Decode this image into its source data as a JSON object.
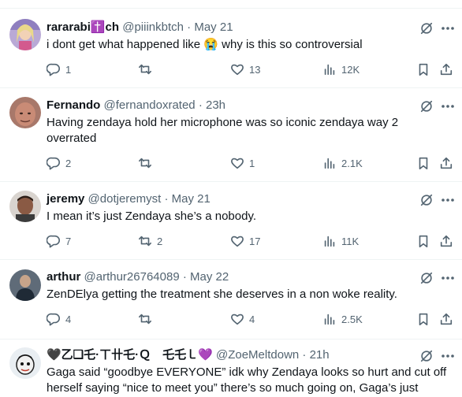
{
  "tweets": [
    {
      "display_name": "rararabi✝️ch",
      "handle": "@piiinkbtch",
      "separator": "·",
      "time": "May 21",
      "text": "i dont get what happened like 😭 why is this so controversial",
      "replies": "1",
      "retweets": "",
      "likes": "13",
      "views": "12K"
    },
    {
      "display_name": "Fernando",
      "handle": "@fernandoxrated",
      "separator": "·",
      "time": "23h",
      "text": "Having zendaya hold her microphone was so iconic zendaya way 2 overrated",
      "replies": "2",
      "retweets": "",
      "likes": "1",
      "views": "2.1K"
    },
    {
      "display_name": "jeremy",
      "handle": "@dotjeremyst",
      "separator": "·",
      "time": "May 21",
      "text": "I mean it’s just Zendaya she’s a nobody.",
      "replies": "7",
      "retweets": "2",
      "likes": "17",
      "views": "11K"
    },
    {
      "display_name": "arthur",
      "handle": "@arthur26764089",
      "separator": "·",
      "time": "May 22",
      "text": "ZenDElya getting the treatment she deserves in a non woke reality.",
      "replies": "4",
      "retweets": "",
      "likes": "4",
      "views": "2.5K"
    },
    {
      "display_name": "🖤乙❑乇·ㄒ卄乇·Ｑ　乇乇㇄💜",
      "handle": "@ZoeMeltdown",
      "separator": "·",
      "time": "21h",
      "text": "Gaga said “goodbye EVERYONE” idk why Zendaya looks so hurt and cut off herself saying “nice to meet you”  there’s so much going on, Gaga’s just"
    }
  ],
  "colors": {
    "text": "#0f1419",
    "secondary": "#536471",
    "divider": "#eff3f4"
  },
  "icons": [
    "reply-icon",
    "retweet-icon",
    "like-icon",
    "views-icon",
    "bookmark-icon",
    "share-icon",
    "grok-icon",
    "more-icon"
  ]
}
